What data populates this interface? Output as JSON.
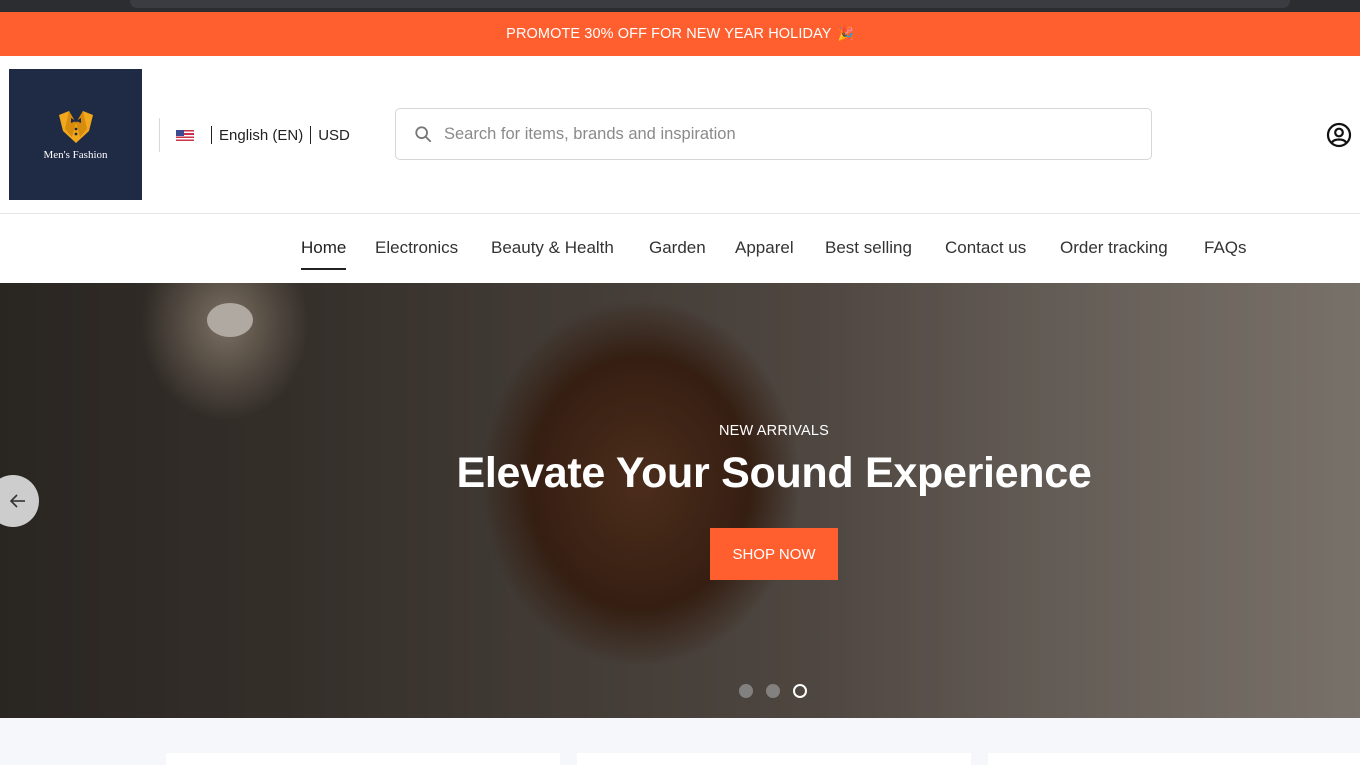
{
  "promo": {
    "text": "PROMOTE 30% OFF FOR NEW YEAR HOLIDAY",
    "emoji": "🎉"
  },
  "brand": {
    "logo_text": "Men's Fashion",
    "logo_bg": "#1f2a44",
    "logo_accent": "#f2a81d"
  },
  "locale": {
    "flag_icon": "us-flag-icon",
    "language": "English (EN)",
    "currency": "USD"
  },
  "search": {
    "placeholder": "Search for items, brands and inspiration",
    "icon": "search-icon"
  },
  "account": {
    "icon": "user-circle-icon"
  },
  "nav": {
    "items": [
      {
        "label": "Home",
        "active": true
      },
      {
        "label": "Electronics"
      },
      {
        "label": "Beauty & Health"
      },
      {
        "label": "Garden"
      },
      {
        "label": "Apparel"
      },
      {
        "label": "Best selling"
      },
      {
        "label": "Contact us"
      },
      {
        "label": "Order tracking"
      },
      {
        "label": "FAQs"
      }
    ]
  },
  "hero": {
    "eyebrow": "NEW ARRIVALS",
    "headline": "Elevate Your Sound Experience",
    "cta": "SHOP NOW",
    "prev_icon": "arrow-left-icon",
    "slide_count": 3,
    "active_slide": 3
  },
  "colors": {
    "accent": "#ff5f2e",
    "text": "#222222",
    "below_bg": "#f5f7fb"
  }
}
